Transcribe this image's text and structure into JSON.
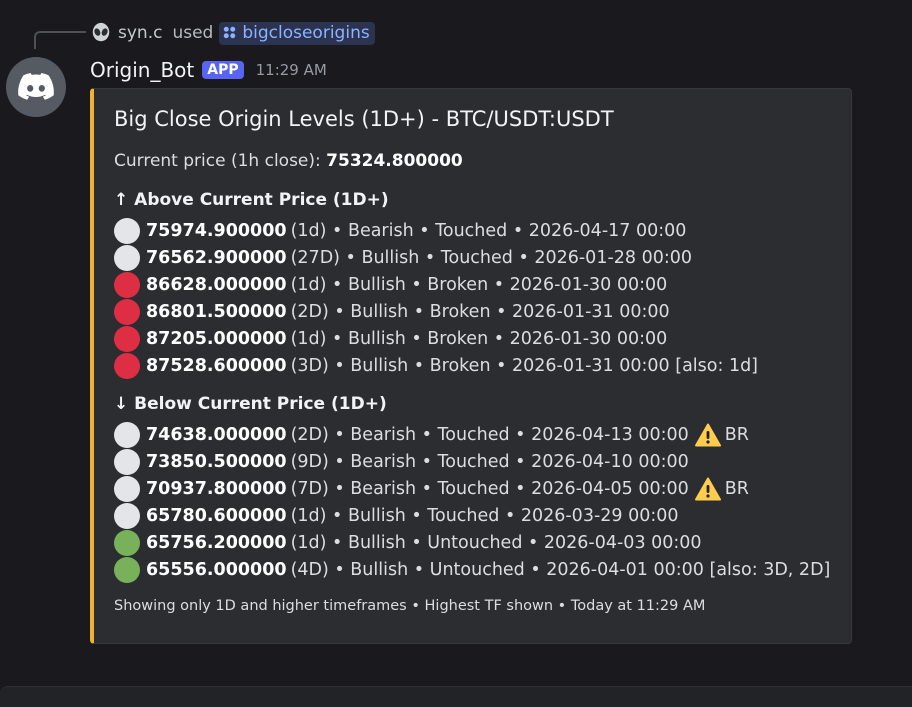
{
  "reply": {
    "user": "syn.c",
    "used_text": "used",
    "command": "bigcloseorigins"
  },
  "message": {
    "author": "Origin_Bot",
    "badge": "APP",
    "time": "11:29 AM"
  },
  "embed": {
    "accent_color": "#f0b232",
    "title": "Big Close Origin Levels (1D+) - BTC/USDT:USDT",
    "current_price_label": "Current price (1h close):",
    "current_price_value": "75324.800000",
    "above_header": "↑ Above Current Price (1D+)",
    "below_header": "↓ Below Current Price (1D+)",
    "above": [
      {
        "color": "white",
        "price": "75974.900000",
        "rest": "(1d) • Bearish • Touched • 2026-04-17 00:00",
        "warn": false,
        "suffix": ""
      },
      {
        "color": "white",
        "price": "76562.900000",
        "rest": "(27D) • Bullish • Touched • 2026-01-28 00:00",
        "warn": false,
        "suffix": ""
      },
      {
        "color": "red",
        "price": "86628.000000",
        "rest": "(1d) • Bullish • Broken • 2026-01-30 00:00",
        "warn": false,
        "suffix": ""
      },
      {
        "color": "red",
        "price": "86801.500000",
        "rest": "(2D) • Bullish • Broken • 2026-01-31 00:00",
        "warn": false,
        "suffix": ""
      },
      {
        "color": "red",
        "price": "87205.000000",
        "rest": "(1d) • Bullish • Broken • 2026-01-30 00:00",
        "warn": false,
        "suffix": ""
      },
      {
        "color": "red",
        "price": "87528.600000",
        "rest": "(3D) • Bullish • Broken • 2026-01-31 00:00 [also: 1d]",
        "warn": false,
        "suffix": ""
      }
    ],
    "below": [
      {
        "color": "white",
        "price": "74638.000000",
        "rest": "(2D) • Bearish • Touched • 2026-04-13 00:00",
        "warn": true,
        "suffix": "BR"
      },
      {
        "color": "white",
        "price": "73850.500000",
        "rest": "(9D) • Bearish • Touched • 2026-04-10 00:00",
        "warn": false,
        "suffix": ""
      },
      {
        "color": "white",
        "price": "70937.800000",
        "rest": "(7D) • Bearish • Touched • 2026-04-05 00:00",
        "warn": true,
        "suffix": "BR"
      },
      {
        "color": "white",
        "price": "65780.600000",
        "rest": "(1d) • Bullish • Touched • 2026-03-29 00:00",
        "warn": false,
        "suffix": ""
      },
      {
        "color": "green",
        "price": "65756.200000",
        "rest": "(1d) • Bullish • Untouched • 2026-04-03 00:00",
        "warn": false,
        "suffix": ""
      },
      {
        "color": "green",
        "price": "65556.000000",
        "rest": "(4D) • Bullish • Untouched • 2026-04-01 00:00 [also: 3D, 2D]",
        "warn": false,
        "suffix": ""
      }
    ],
    "footer": "Showing only 1D and higher timeframes • Highest TF shown • Today at 11:29 AM"
  },
  "colors": {
    "white": "#e3e5e8",
    "red": "#dd2e44",
    "green": "#78b159",
    "warning": "#ffcc4d",
    "badge": "#5865f2"
  }
}
